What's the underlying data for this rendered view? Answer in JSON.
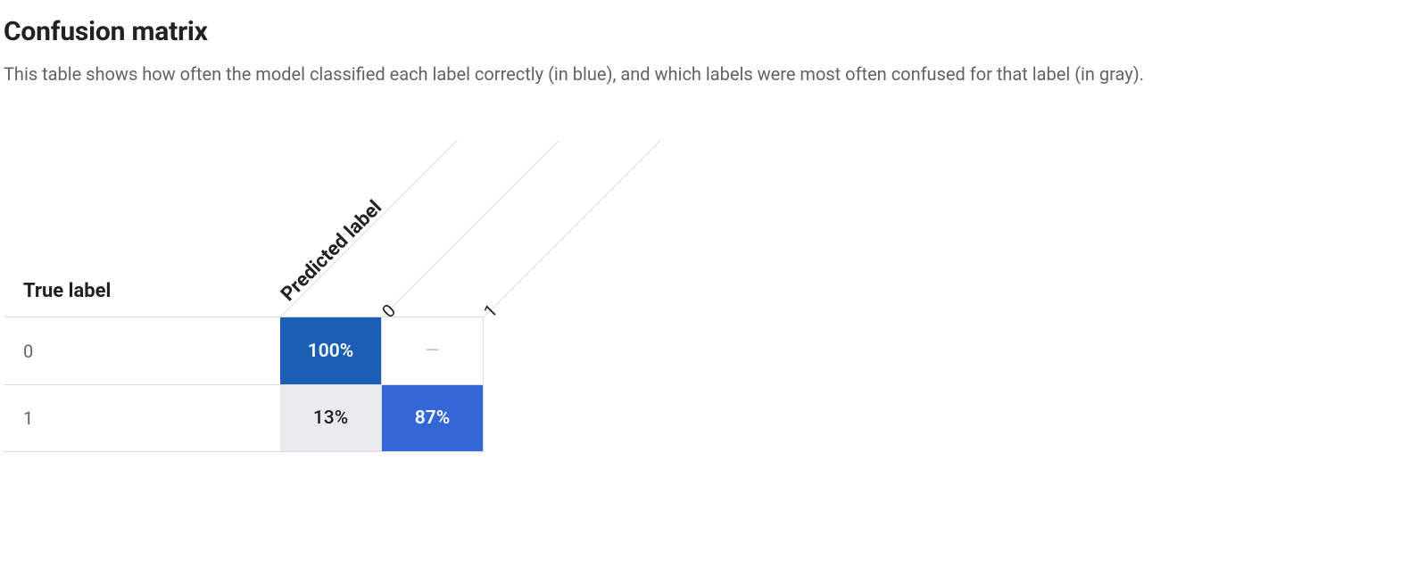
{
  "title": "Confusion matrix",
  "description": "This table shows how often the model classified each label correctly (in blue), and which labels were most often confused for that label (in gray).",
  "axes": {
    "true_label": "True label",
    "predicted_label": "Predicted label"
  },
  "columns": [
    "0",
    "1"
  ],
  "rows": [
    {
      "label": "0",
      "cells": [
        "100%",
        "—"
      ]
    },
    {
      "label": "1",
      "cells": [
        "13%",
        "87%"
      ]
    }
  ],
  "chart_data": {
    "type": "heatmap",
    "title": "Confusion matrix",
    "xlabel": "Predicted label",
    "ylabel": "True label",
    "categories_x": [
      "0",
      "1"
    ],
    "categories_y": [
      "0",
      "1"
    ],
    "values_display": [
      [
        "100%",
        "—"
      ],
      [
        "13%",
        "87%"
      ]
    ],
    "values": [
      [
        100,
        0
      ],
      [
        13,
        87
      ]
    ],
    "correct_color": "#1a5fb4",
    "confused_color": "#e8eaed"
  }
}
